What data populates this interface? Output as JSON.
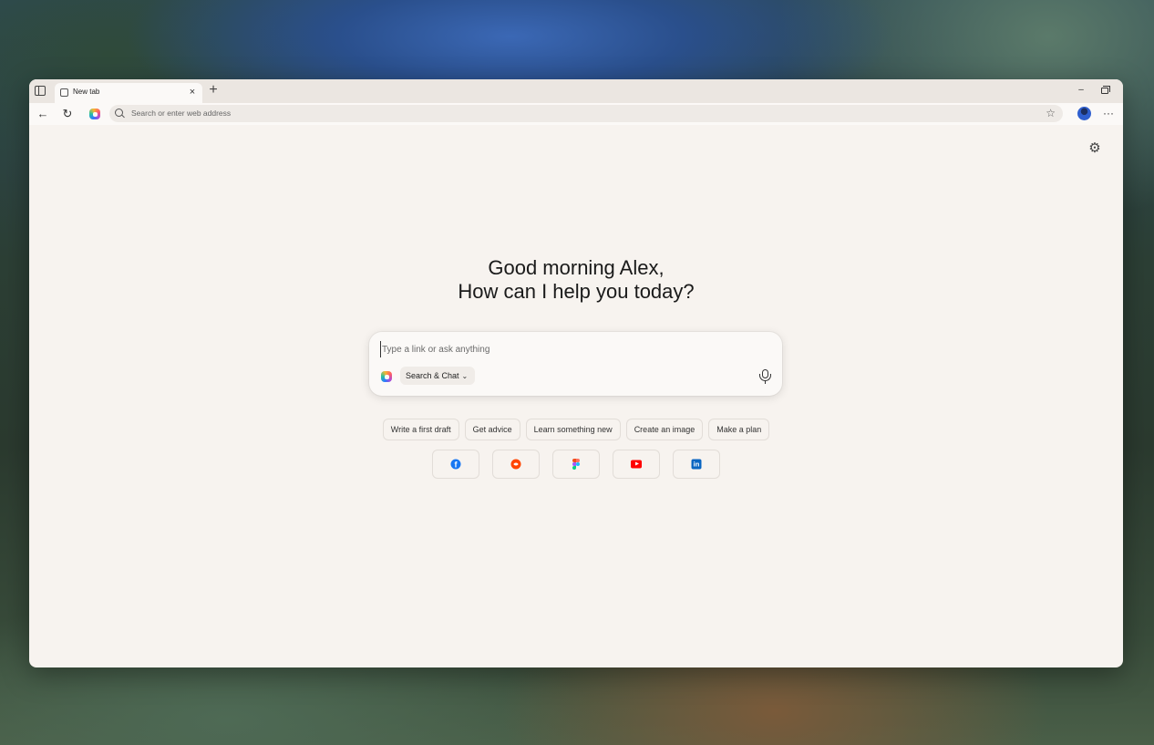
{
  "browser": {
    "tab": {
      "title": "New tab",
      "close_glyph": "×"
    },
    "new_tab_glyph": "+",
    "window_controls": {
      "minimize_glyph": "–"
    },
    "toolbar": {
      "back_glyph": "←",
      "reload_glyph": "↻",
      "address_placeholder": "Search or enter web address",
      "favorites_glyph": "☆",
      "more_glyph": "···"
    }
  },
  "newtab": {
    "settings_glyph": "⚙",
    "greeting_line1": "Good morning Alex,",
    "greeting_line2": "How can I help you today?",
    "composer": {
      "placeholder": "Type a link or ask anything",
      "mode_label": "Search & Chat",
      "mode_chevron": "⌄"
    },
    "suggestions": [
      "Write a first draft",
      "Get advice",
      "Learn something new",
      "Create an image",
      "Make a plan"
    ],
    "shortcuts": [
      {
        "site": "Facebook",
        "icon": "facebook-icon",
        "glyph": "f"
      },
      {
        "site": "Reddit",
        "icon": "reddit-icon"
      },
      {
        "site": "Figma",
        "icon": "figma-icon"
      },
      {
        "site": "YouTube",
        "icon": "youtube-icon"
      },
      {
        "site": "LinkedIn",
        "icon": "linkedin-icon",
        "glyph": "in"
      }
    ]
  },
  "colors": {
    "page_background": "#f7f3ef",
    "tabstrip_background": "#ebe6e1",
    "facebook": "#1877f2",
    "reddit": "#ff4500",
    "youtube": "#ff0000",
    "linkedin": "#0a66c2"
  }
}
